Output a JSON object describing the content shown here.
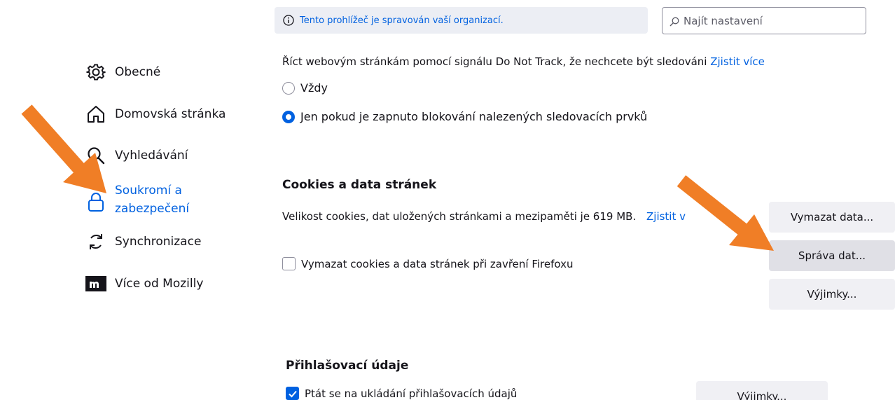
{
  "banner": {
    "text": "Tento prohlížeč je spravován vaší organizací."
  },
  "search": {
    "placeholder": "Najít nastavení"
  },
  "sidebar": {
    "items": [
      {
        "label": "Obecné"
      },
      {
        "label": "Domovská stránka"
      },
      {
        "label": "Vyhledávání"
      },
      {
        "label": "Soukromí a",
        "label2": "zabezpečení"
      },
      {
        "label": "Synchronizace"
      },
      {
        "label": "Více od Mozilly"
      }
    ]
  },
  "tracking": {
    "cut_text": "Říct webovým stránkám pomocí signálu Do Not Track, že nechcete být sledováni",
    "cut_link": "Zjistit více",
    "options": [
      {
        "label": "Vždy",
        "checked": false
      },
      {
        "label": "Jen pokud je zapnuto blokování nalezených sledovacích prvků",
        "checked": true
      }
    ]
  },
  "cookies": {
    "title": "Cookies a data stránek",
    "description": "Velikost cookies, dat uložených stránkami a mezipaměti je 619 MB.",
    "learn_more": "Zjistit v",
    "clear_label": "Vymazat cookies a data stránek při zavření Firefoxu",
    "buttons": {
      "clear_data": "Vymazat data...",
      "manage_data": "Správa dat...",
      "exceptions": "Výjimky..."
    }
  },
  "logins": {
    "title": "Přihlašovací údaje",
    "ask_save_label": "Ptát se na ukládání přihlašovacích údajů",
    "exceptions_button": "Výjimky..."
  },
  "colors": {
    "accent": "#0061e0",
    "arrow": "#f07e26"
  }
}
